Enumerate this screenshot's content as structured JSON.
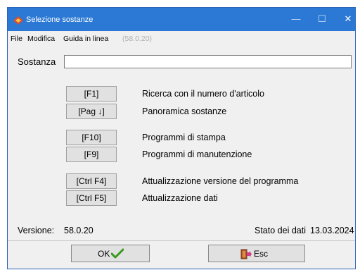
{
  "window": {
    "title": "Selezione sostanze",
    "minimize": "—",
    "maximize": "☐",
    "close": "✕"
  },
  "menu": {
    "file": "File",
    "modifica": "Modifica",
    "guida": "Guida in linea",
    "version": "(58.0.20)"
  },
  "search": {
    "label": "Sostanza",
    "value": ""
  },
  "actions": [
    {
      "key": "[F1]",
      "description": "Ricerca con il numero d'articolo"
    },
    {
      "key": "[Pag ↓]",
      "description": "Panoramica sostanze"
    },
    {
      "key": "[F10]",
      "description": "Programmi di stampa"
    },
    {
      "key": "[F9]",
      "description": "Programmi di manutenzione"
    },
    {
      "key": "[Ctrl F4]",
      "description": "Attualizzazione versione del programma"
    },
    {
      "key": "[Ctrl F5]",
      "description": "Attualizzazione dati"
    }
  ],
  "status": {
    "version_label": "Versione:",
    "version_value": "58.0.20",
    "data_label": "Stato dei dati",
    "data_value": "13.03.2024"
  },
  "buttons": {
    "ok": "OK",
    "esc": "Esc"
  },
  "colors": {
    "titlebar": "#2b79d4",
    "ok_check": "#3a9a1e"
  }
}
